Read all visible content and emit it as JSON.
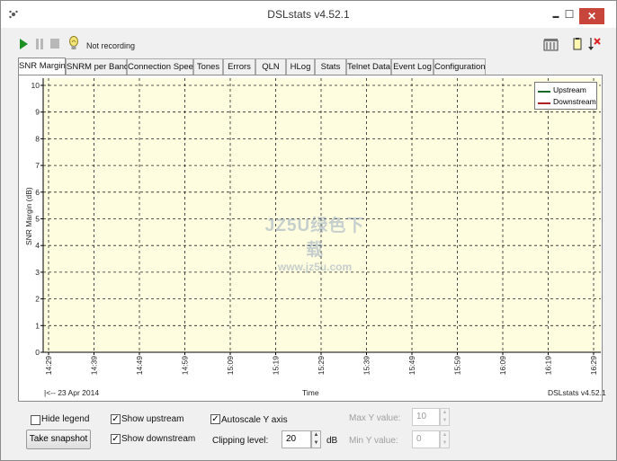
{
  "window": {
    "title": "DSLstats v4.52.1",
    "minimize_glyph": "▬",
    "maximize_glyph": "☐",
    "close_glyph": "✕"
  },
  "toolbar": {
    "status": "Not recording",
    "icons": [
      "play-icon",
      "pause-icon",
      "stop-icon",
      "bulb-icon",
      "database-icon",
      "copy-icon",
      "clear-icon"
    ]
  },
  "tabs": [
    {
      "label": "SNR Margin",
      "active": true
    },
    {
      "label": "SNRM per Band"
    },
    {
      "label": "Connection Speed"
    },
    {
      "label": "Tones"
    },
    {
      "label": "Errors"
    },
    {
      "label": "QLN"
    },
    {
      "label": "HLog"
    },
    {
      "label": "Stats"
    },
    {
      "label": "Telnet Data"
    },
    {
      "label": "Event Log"
    },
    {
      "label": "Configuration"
    }
  ],
  "chart_data": {
    "type": "line",
    "ylabel": "SNR Margin (dB)",
    "xlabel": "Time",
    "y_ticks": [
      "10",
      "9",
      "8",
      "7",
      "6",
      "5",
      "4",
      "3",
      "2",
      "1",
      "0"
    ],
    "ylim": [
      0,
      10
    ],
    "x_ticks": [
      "14:29",
      "14:39",
      "14:49",
      "14:59",
      "15:09",
      "15:19",
      "15:29",
      "15:39",
      "15:49",
      "15:59",
      "16:09",
      "16:19",
      "16:29"
    ],
    "grid": true,
    "legend_position": "top-right",
    "series": [
      {
        "name": "Upstream",
        "color": "#1a6b2a",
        "values": []
      },
      {
        "name": "Downstream",
        "color": "#b02020",
        "values": []
      }
    ],
    "plot_background": "#fffde0",
    "date_label": "|<-- 23 Apr 2014",
    "version_label": "DSLstats v4.52.1"
  },
  "watermark": {
    "line1": "JZ5U绿色下载",
    "line2": "www.jz5u.com"
  },
  "controls": {
    "hide_legend": {
      "label": "Hide legend",
      "checked": false
    },
    "show_upstream": {
      "label": "Show upstream",
      "checked": true
    },
    "show_downstream": {
      "label": "Show downstream",
      "checked": true
    },
    "autoscale": {
      "label": "Autoscale Y axis",
      "checked": true
    },
    "clipping_label": "Clipping level:",
    "clipping_value": "20",
    "clipping_unit": "dB",
    "max_y_label": "Max Y value:",
    "max_y_value": "10",
    "min_y_label": "Min Y value:",
    "min_y_value": "0",
    "snapshot_label": "Take snapshot",
    "check_glyph": "✓"
  }
}
